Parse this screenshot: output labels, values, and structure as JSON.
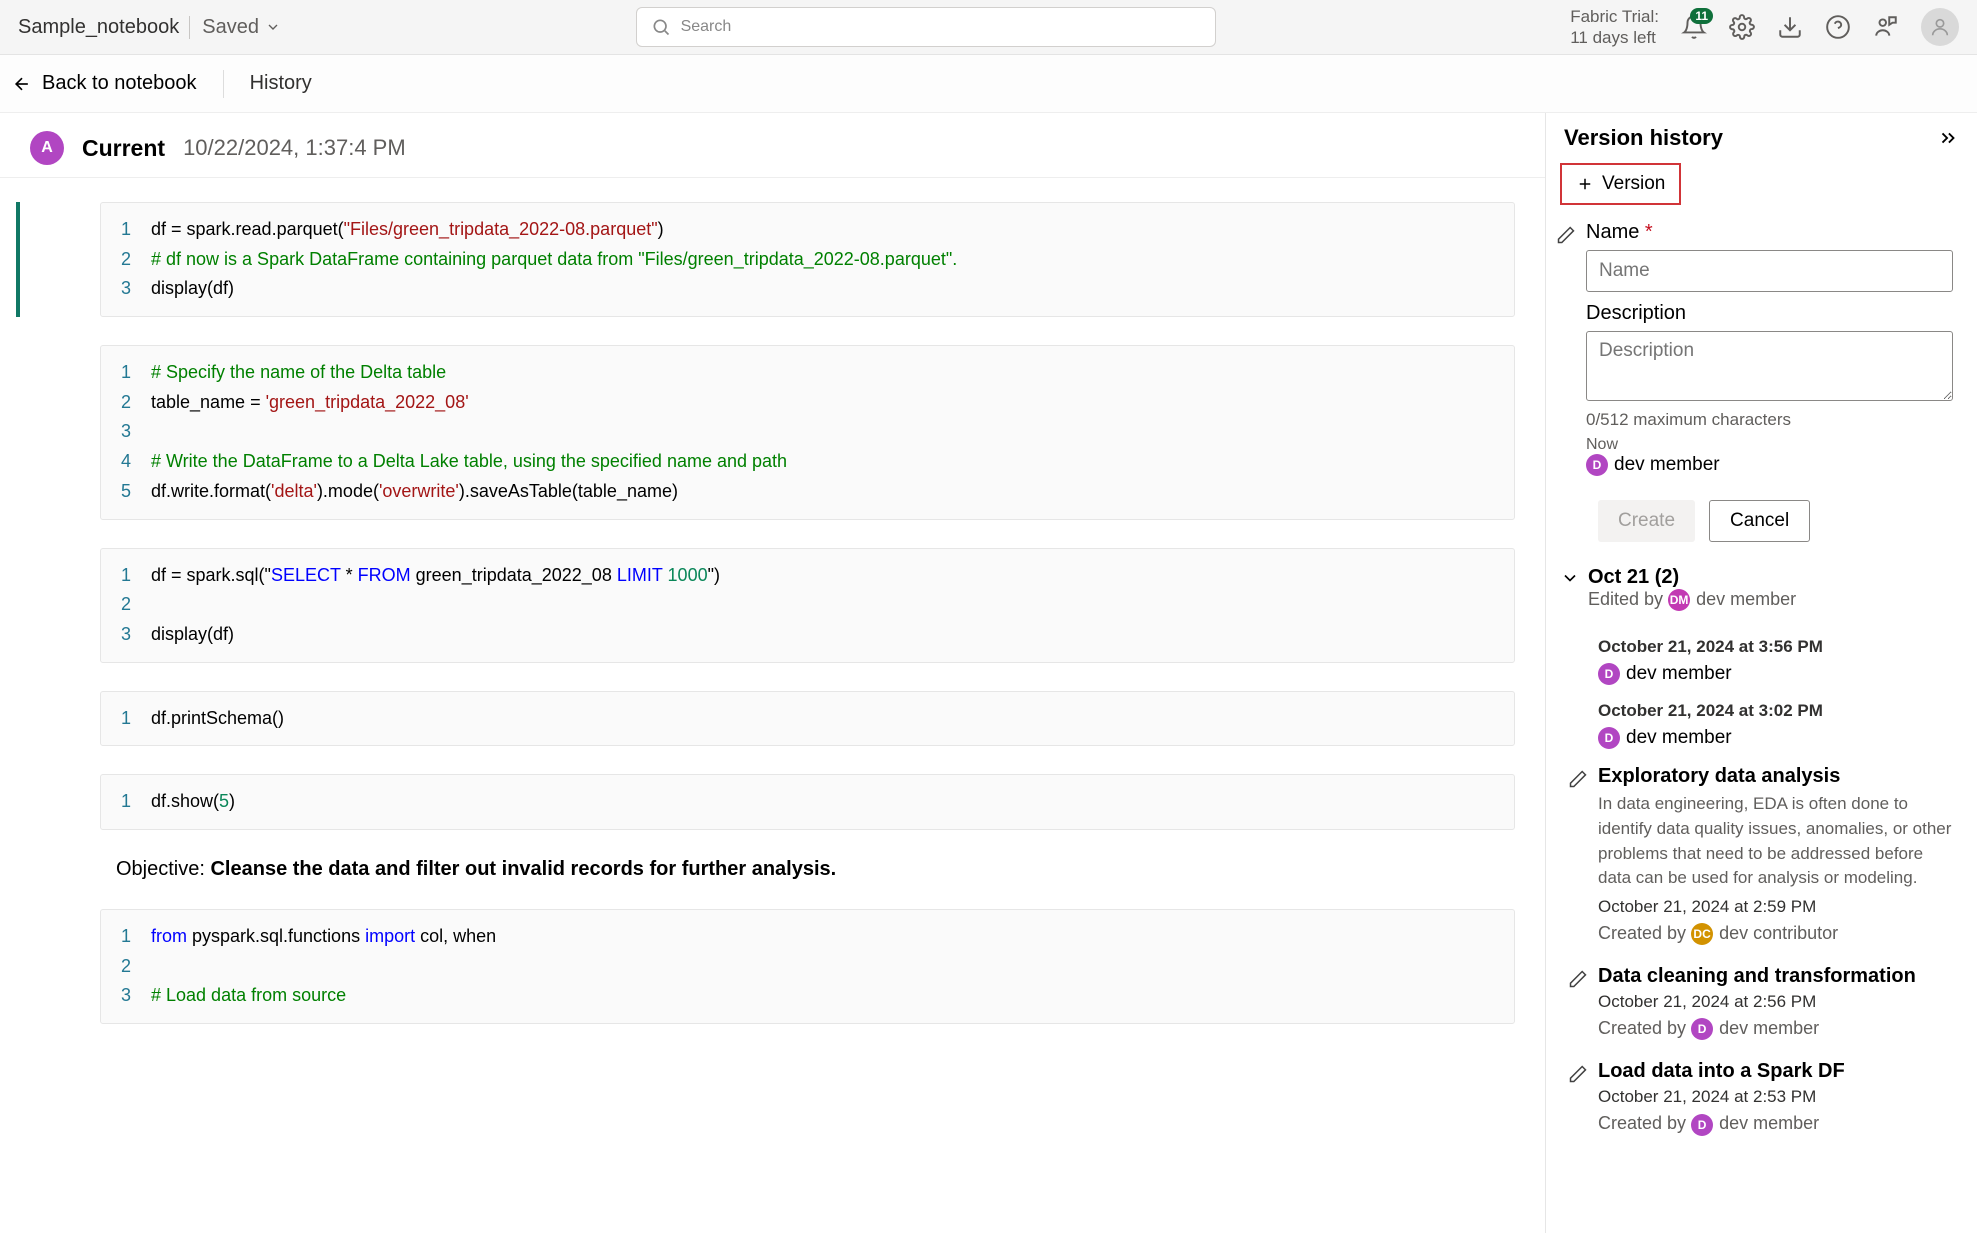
{
  "topbar": {
    "notebook_name": "Sample_notebook",
    "saved_label": "Saved",
    "search_placeholder": "Search",
    "trial_line1": "Fabric Trial:",
    "trial_line2": "11 days left",
    "notif_count": "11"
  },
  "navbar": {
    "back_label": "Back to notebook",
    "crumb": "History"
  },
  "header": {
    "avatar_initial": "A",
    "current_label": "Current",
    "timestamp": "10/22/2024, 1:37:4 PM"
  },
  "cells": {
    "c1": {
      "l1a": "df = spark.read.parquet(",
      "l1s": "\"Files/green_tripdata_2022-08.parquet\"",
      "l1b": ")",
      "l2c": "# df now is a Spark DataFrame containing parquet data from \"Files/green_tripdata_2022-08.parquet\".",
      "l3": "display(df)"
    },
    "c2": {
      "l1c": "# Specify the name of the Delta table",
      "l2a": "table_name = ",
      "l2s": "'green_tripdata_2022_08'",
      "l3": "",
      "l4c": "# Write the DataFrame to a Delta Lake table, using the specified name and path",
      "l5a": "df.write.format(",
      "l5s1": "'delta'",
      "l5b": ").mode(",
      "l5s2": "'overwrite'",
      "l5c2": ").saveAsTable(table_name)"
    },
    "c3": {
      "l1a": "df = spark.sql(\"",
      "l1k1": "SELECT",
      "l1t1": " * ",
      "l1k2": "FROM",
      "l1t2": " green_tripdata_2022_08 ",
      "l1k3": "LIMIT",
      "l1sp": " ",
      "l1n": "1000",
      "l1b": "\")",
      "l2": "",
      "l3": "display(df)"
    },
    "c4": {
      "l1": "df.printSchema()"
    },
    "c5": {
      "l1a": "df.show(",
      "l1n": "5",
      "l1b": ")"
    },
    "prose_label": "Objective: ",
    "prose_bold": "Cleanse the data and filter out invalid records for further analysis.",
    "c6": {
      "l1k1": "from",
      "l1t1": " pyspark.sql.functions ",
      "l1k2": "import",
      "l1t2": " col, when",
      "l2": "",
      "l3c": "# Load data from source"
    }
  },
  "panel": {
    "title": "Version history",
    "version_btn": "Version",
    "name_label": "Name",
    "name_required": "*",
    "name_placeholder": "Name",
    "desc_label": "Description",
    "desc_placeholder": "Description",
    "charcount": "0/512 maximum characters",
    "now": "Now",
    "now_user": "dev member",
    "now_badge": "D",
    "create_btn": "Create",
    "cancel_btn": "Cancel",
    "group": {
      "title": "Oct 21 (2)",
      "edited_by": "Edited by",
      "editor_badge": "DM",
      "editor": "dev member"
    },
    "items": [
      {
        "time": "October 21, 2024 at 3:56 PM",
        "badge": "D",
        "user": "dev member"
      },
      {
        "time": "October 21, 2024 at 3:02 PM",
        "badge": "D",
        "user": "dev member"
      }
    ],
    "named": [
      {
        "title": "Exploratory data analysis",
        "desc": "In data engineering, EDA is often done to identify data quality issues, anomalies, or other problems that need to be addressed before data can be used for analysis or modeling.",
        "time": "October 21, 2024 at 2:59 PM",
        "created_by": "Created by",
        "badge": "DC",
        "user": "dev contributor"
      },
      {
        "title": "Data cleaning and transformation",
        "time": "October 21, 2024 at 2:56 PM",
        "created_by": "Created by",
        "badge": "D",
        "user": "dev member"
      },
      {
        "title": "Load data into a Spark DF",
        "time": "October 21, 2024 at 2:53 PM",
        "created_by": "Created by",
        "badge": "D",
        "user": "dev member"
      }
    ]
  }
}
